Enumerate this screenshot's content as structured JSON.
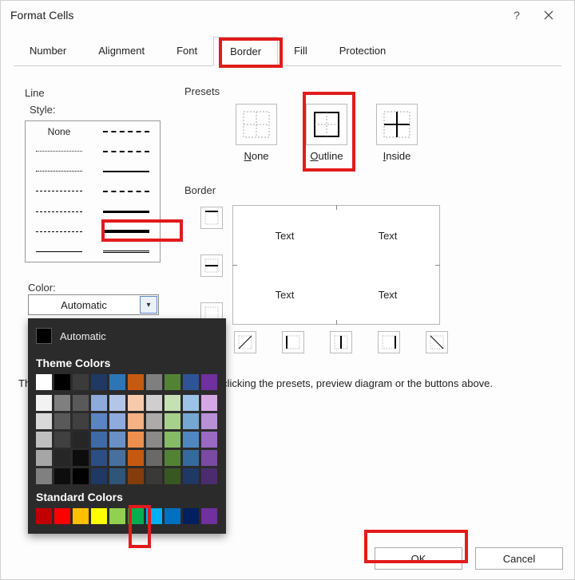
{
  "window": {
    "title": "Format Cells"
  },
  "tabs": [
    "Number",
    "Alignment",
    "Font",
    "Border",
    "Fill",
    "Protection"
  ],
  "active_tab": "Border",
  "line": {
    "section": "Line",
    "style_label": "Style:",
    "none_label": "None"
  },
  "presets": {
    "section": "Presets",
    "items": [
      {
        "label": "None"
      },
      {
        "label": "Outline"
      },
      {
        "label": "Inside"
      }
    ]
  },
  "border": {
    "section": "Border"
  },
  "preview": {
    "cells": [
      "Text",
      "Text",
      "Text",
      "Text"
    ]
  },
  "color": {
    "label": "Color:",
    "value": "Automatic"
  },
  "color_popup": {
    "automatic": "Automatic",
    "theme_header": "Theme Colors",
    "standard_header": "Standard Colors",
    "theme_row0": [
      "#ffffff",
      "#000000",
      "#3b3b3b",
      "#1f3864",
      "#2e75b6",
      "#c55a11",
      "#7f7f7f",
      "#548235",
      "#2f5496",
      "#7030a0"
    ],
    "theme_shades": [
      [
        "#f2f2f2",
        "#7f7f7f",
        "#595959",
        "#8eaadb",
        "#b4c6e7",
        "#f7caac",
        "#d0cece",
        "#c5e0b3",
        "#9cc2e5",
        "#d6a7e7"
      ],
      [
        "#d9d9d9",
        "#595959",
        "#404040",
        "#5b84c4",
        "#8faadc",
        "#f4b183",
        "#aeaaaa",
        "#a8d08d",
        "#75a7d3",
        "#b98fd6"
      ],
      [
        "#bfbfbf",
        "#404040",
        "#262626",
        "#3e6aa8",
        "#6a90c6",
        "#ed8f4e",
        "#8c8989",
        "#86bb66",
        "#4f88c1",
        "#9a6ac2"
      ],
      [
        "#a6a6a6",
        "#262626",
        "#0d0d0d",
        "#2c4e84",
        "#47709f",
        "#c65911",
        "#6b6868",
        "#548235",
        "#356a9e",
        "#7b4aa2"
      ],
      [
        "#808080",
        "#0d0d0d",
        "#000000",
        "#1f3864",
        "#2f5579",
        "#843c0c",
        "#3b3838",
        "#385723",
        "#1f3864",
        "#4b2c6f"
      ]
    ],
    "standard": [
      "#c00000",
      "#ff0000",
      "#ffc000",
      "#ffff00",
      "#92d050",
      "#00b050",
      "#00b0f0",
      "#0070c0",
      "#002060",
      "#7030a0"
    ]
  },
  "hint_prefix": "Th",
  "hint_suffix": " by clicking the presets, preview diagram or the buttons above.",
  "buttons": {
    "ok": "OK",
    "cancel": "Cancel"
  }
}
